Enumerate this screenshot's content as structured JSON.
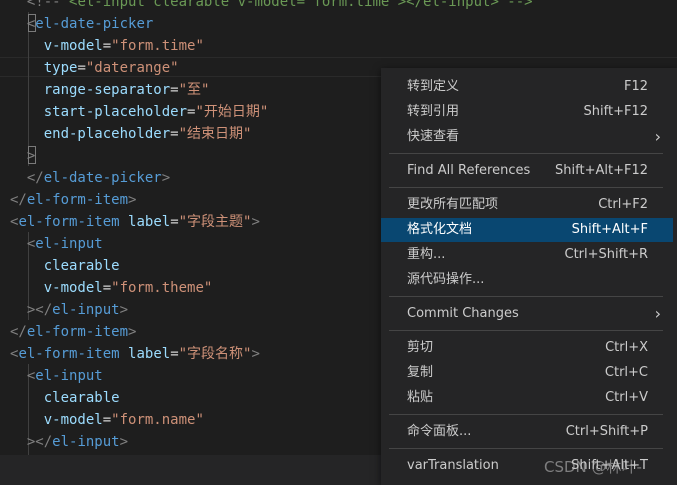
{
  "editor": {
    "lines": [
      [
        {
          "c": "t-punc",
          "t": "  <!-- "
        },
        {
          "c": "t-comment",
          "t": "<el-input clearable v-model=\"form.time\"></el-input> -->"
        }
      ],
      [
        {
          "c": "t-punc",
          "t": "  <"
        },
        {
          "c": "t-tag",
          "t": "el-date-picker"
        }
      ],
      [
        {
          "c": "t-attr",
          "t": "    v-model"
        },
        {
          "c": "",
          "t": "="
        },
        {
          "c": "t-str",
          "t": "\"form.time\""
        }
      ],
      [
        {
          "c": "t-attr",
          "t": "    type"
        },
        {
          "c": "",
          "t": "="
        },
        {
          "c": "t-str",
          "t": "\"daterange\""
        }
      ],
      [
        {
          "c": "t-attr",
          "t": "    range-separator"
        },
        {
          "c": "",
          "t": "="
        },
        {
          "c": "t-str",
          "t": "\"至\""
        }
      ],
      [
        {
          "c": "t-attr",
          "t": "    start-placeholder"
        },
        {
          "c": "",
          "t": "="
        },
        {
          "c": "t-str",
          "t": "\"开始日期\""
        }
      ],
      [
        {
          "c": "t-attr",
          "t": "    end-placeholder"
        },
        {
          "c": "",
          "t": "="
        },
        {
          "c": "t-str",
          "t": "\"结束日期\""
        }
      ],
      [
        {
          "c": "t-punc",
          "t": "  >"
        }
      ],
      [
        {
          "c": "t-punc",
          "t": "  </"
        },
        {
          "c": "t-tag",
          "t": "el-date-picker"
        },
        {
          "c": "t-punc",
          "t": ">"
        }
      ],
      [
        {
          "c": "t-punc",
          "t": "</"
        },
        {
          "c": "t-tag",
          "t": "el-form-item"
        },
        {
          "c": "t-punc",
          "t": ">"
        }
      ],
      [
        {
          "c": "t-punc",
          "t": "<"
        },
        {
          "c": "t-tag",
          "t": "el-form-item"
        },
        {
          "c": "",
          "t": " "
        },
        {
          "c": "t-attr",
          "t": "label"
        },
        {
          "c": "",
          "t": "="
        },
        {
          "c": "t-str",
          "t": "\"字段主题\""
        },
        {
          "c": "t-punc",
          "t": ">"
        }
      ],
      [
        {
          "c": "t-punc",
          "t": "  <"
        },
        {
          "c": "t-tag",
          "t": "el-input"
        }
      ],
      [
        {
          "c": "t-attr",
          "t": "    clearable"
        }
      ],
      [
        {
          "c": "t-attr",
          "t": "    v-model"
        },
        {
          "c": "",
          "t": "="
        },
        {
          "c": "t-str",
          "t": "\"form.theme\""
        }
      ],
      [
        {
          "c": "t-punc",
          "t": "  ></"
        },
        {
          "c": "t-tag",
          "t": "el-input"
        },
        {
          "c": "t-punc",
          "t": ">"
        }
      ],
      [
        {
          "c": "t-punc",
          "t": "</"
        },
        {
          "c": "t-tag",
          "t": "el-form-item"
        },
        {
          "c": "t-punc",
          "t": ">"
        }
      ],
      [
        {
          "c": "t-punc",
          "t": "<"
        },
        {
          "c": "t-tag",
          "t": "el-form-item"
        },
        {
          "c": "",
          "t": " "
        },
        {
          "c": "t-attr",
          "t": "label"
        },
        {
          "c": "",
          "t": "="
        },
        {
          "c": "t-str",
          "t": "\"字段名称\""
        },
        {
          "c": "t-punc",
          "t": ">"
        }
      ],
      [
        {
          "c": "t-punc",
          "t": "  <"
        },
        {
          "c": "t-tag",
          "t": "el-input"
        }
      ],
      [
        {
          "c": "t-attr",
          "t": "    clearable"
        }
      ],
      [
        {
          "c": "t-attr",
          "t": "    v-model"
        },
        {
          "c": "",
          "t": "="
        },
        {
          "c": "t-str",
          "t": "\"form.name\""
        }
      ],
      [
        {
          "c": "t-punc",
          "t": "  ></"
        },
        {
          "c": "t-tag",
          "t": "el-input"
        },
        {
          "c": "t-punc",
          "t": ">"
        }
      ]
    ]
  },
  "context_menu": {
    "items": [
      {
        "label": "转到定义",
        "shortcut": "F12"
      },
      {
        "label": "转到引用",
        "shortcut": "Shift+F12"
      },
      {
        "label": "快速查看",
        "submenu_arrow": "›"
      },
      {
        "label": "Find All References",
        "shortcut": "Shift+Alt+F12"
      },
      {
        "label": "更改所有匹配项",
        "shortcut": "Ctrl+F2"
      },
      {
        "label": "格式化文档",
        "shortcut": "Shift+Alt+F",
        "active": true
      },
      {
        "label": "重构...",
        "shortcut": "Ctrl+Shift+R"
      },
      {
        "label": "源代码操作..."
      },
      {
        "label": "Commit Changes",
        "submenu_arrow": "›"
      },
      {
        "label": "剪切",
        "shortcut": "Ctrl+X"
      },
      {
        "label": "复制",
        "shortcut": "Ctrl+C"
      },
      {
        "label": "粘贴",
        "shortcut": "Ctrl+V"
      },
      {
        "label": "命令面板...",
        "shortcut": "Ctrl+Shift+P"
      },
      {
        "label": "varTranslation",
        "shortcut": "Shift+Alt+T"
      }
    ]
  },
  "watermark": "CSDN @林叶-",
  "colors": {
    "editor_bg": "#1e1e1e",
    "menu_bg": "#252526",
    "menu_active_bg": "#094771",
    "tag": "#569cd6",
    "attribute": "#9cdcfe",
    "string": "#ce9178",
    "punctuation": "#808080"
  }
}
